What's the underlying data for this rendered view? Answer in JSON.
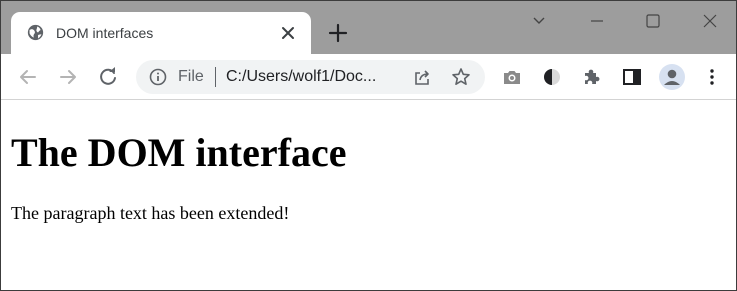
{
  "browser": {
    "tab": {
      "title": "DOM interfaces",
      "icon": "globe-icon"
    },
    "address_bar": {
      "scheme_label": "File",
      "url": "C:/Users/wolf1/Doc..."
    },
    "icons": {
      "back": "arrow-left-icon",
      "forward": "arrow-right-icon",
      "reload": "reload-icon",
      "info": "info-icon",
      "share": "share-icon",
      "bookmark": "star-icon",
      "camera": "camera-icon",
      "contrast": "contrast-icon",
      "extensions": "puzzle-icon",
      "side_panel": "side-panel-icon",
      "profile": "avatar-icon",
      "menu": "kebab-menu-icon"
    },
    "colors": {
      "tabstrip": "#9d9d9d",
      "omnibox": "#f1f3f4",
      "icon_gray": "#5f6368"
    }
  },
  "page": {
    "heading": "The DOM interface",
    "paragraph": "The paragraph text has been extended!"
  }
}
